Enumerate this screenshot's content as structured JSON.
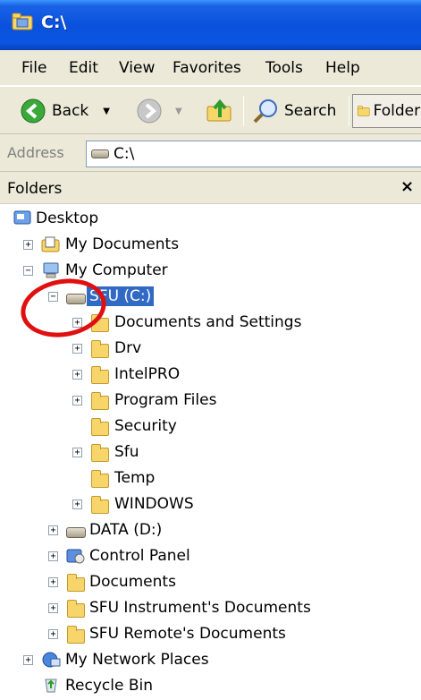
{
  "window": {
    "title": "C:\\"
  },
  "menu": [
    "File",
    "Edit",
    "View",
    "Favorites",
    "Tools",
    "Help"
  ],
  "toolbar": {
    "back": "Back",
    "search": "Search",
    "folders": "Folders"
  },
  "address": {
    "label": "Address",
    "value": "C:\\"
  },
  "folders_pane": {
    "title": "Folders",
    "close": "×"
  },
  "tree": {
    "desktop": "Desktop",
    "my_documents": "My Documents",
    "my_computer": "My Computer",
    "sfu_c": "SFU (C:)",
    "documents_and_settings": "Documents and Settings",
    "drv": "Drv",
    "intelpro": "IntelPRO",
    "program_files": "Program Files",
    "security": "Security",
    "sfu": "Sfu",
    "temp": "Temp",
    "windows": "WINDOWS",
    "data_d": "DATA (D:)",
    "control_panel": "Control Panel",
    "documents": "Documents",
    "sfu_instrument_docs": "SFU Instrument's Documents",
    "sfu_remote_docs": "SFU Remote's Documents",
    "my_network_places": "My Network Places",
    "recycle_bin": "Recycle Bin"
  },
  "colors": {
    "titlebar": "#0a52dc",
    "selection": "#316ac5",
    "annotation": "#e01010"
  },
  "annotation": "red-circle-highlighting-sfu-c-drive"
}
